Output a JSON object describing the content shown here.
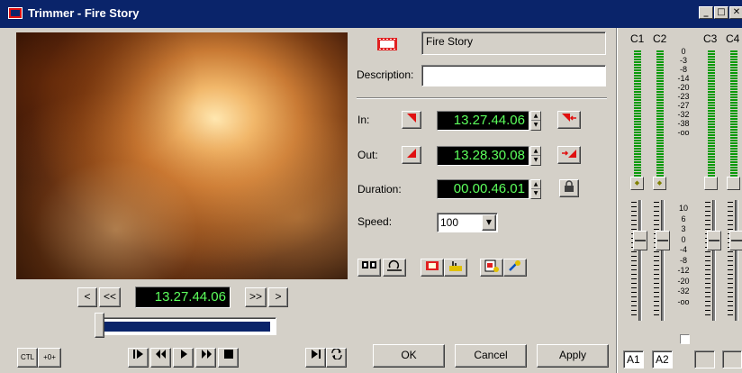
{
  "window": {
    "title": "Trimmer - Fire Story",
    "controls": [
      "_",
      "□",
      "✕"
    ]
  },
  "clip": {
    "name": "Fire Story",
    "description_label": "Description:",
    "description_value": ""
  },
  "in": {
    "label": "In:",
    "timecode": "13.27.44.06"
  },
  "out": {
    "label": "Out:",
    "timecode": "13.28.30.08"
  },
  "duration": {
    "label": "Duration:",
    "timecode": "00.00.46.01"
  },
  "speed": {
    "label": "Speed:",
    "value": "100"
  },
  "transport": {
    "prev": "<",
    "prev_fast": "<<",
    "current_timecode": "13.27.44.06",
    "next_fast": ">>",
    "next": ">",
    "position_fraction": 0.02
  },
  "bottom": {
    "ctl": "CTL",
    "add": "+0+"
  },
  "buttons": {
    "ok": "OK",
    "cancel": "Cancel",
    "apply": "Apply"
  },
  "audio": {
    "channels": [
      "C1",
      "C2",
      "C3",
      "C4"
    ],
    "scale_top": [
      "0",
      "-3",
      "-8",
      "-14",
      "-20",
      "-23",
      "-27",
      "-32",
      "-38",
      "-oo"
    ],
    "scale_bottom": [
      "10",
      "6",
      "3",
      "0",
      "-4",
      "-8",
      "-12",
      "-20",
      "-32",
      "-oo"
    ],
    "outputs": [
      "A1",
      "A2",
      "",
      ""
    ]
  }
}
